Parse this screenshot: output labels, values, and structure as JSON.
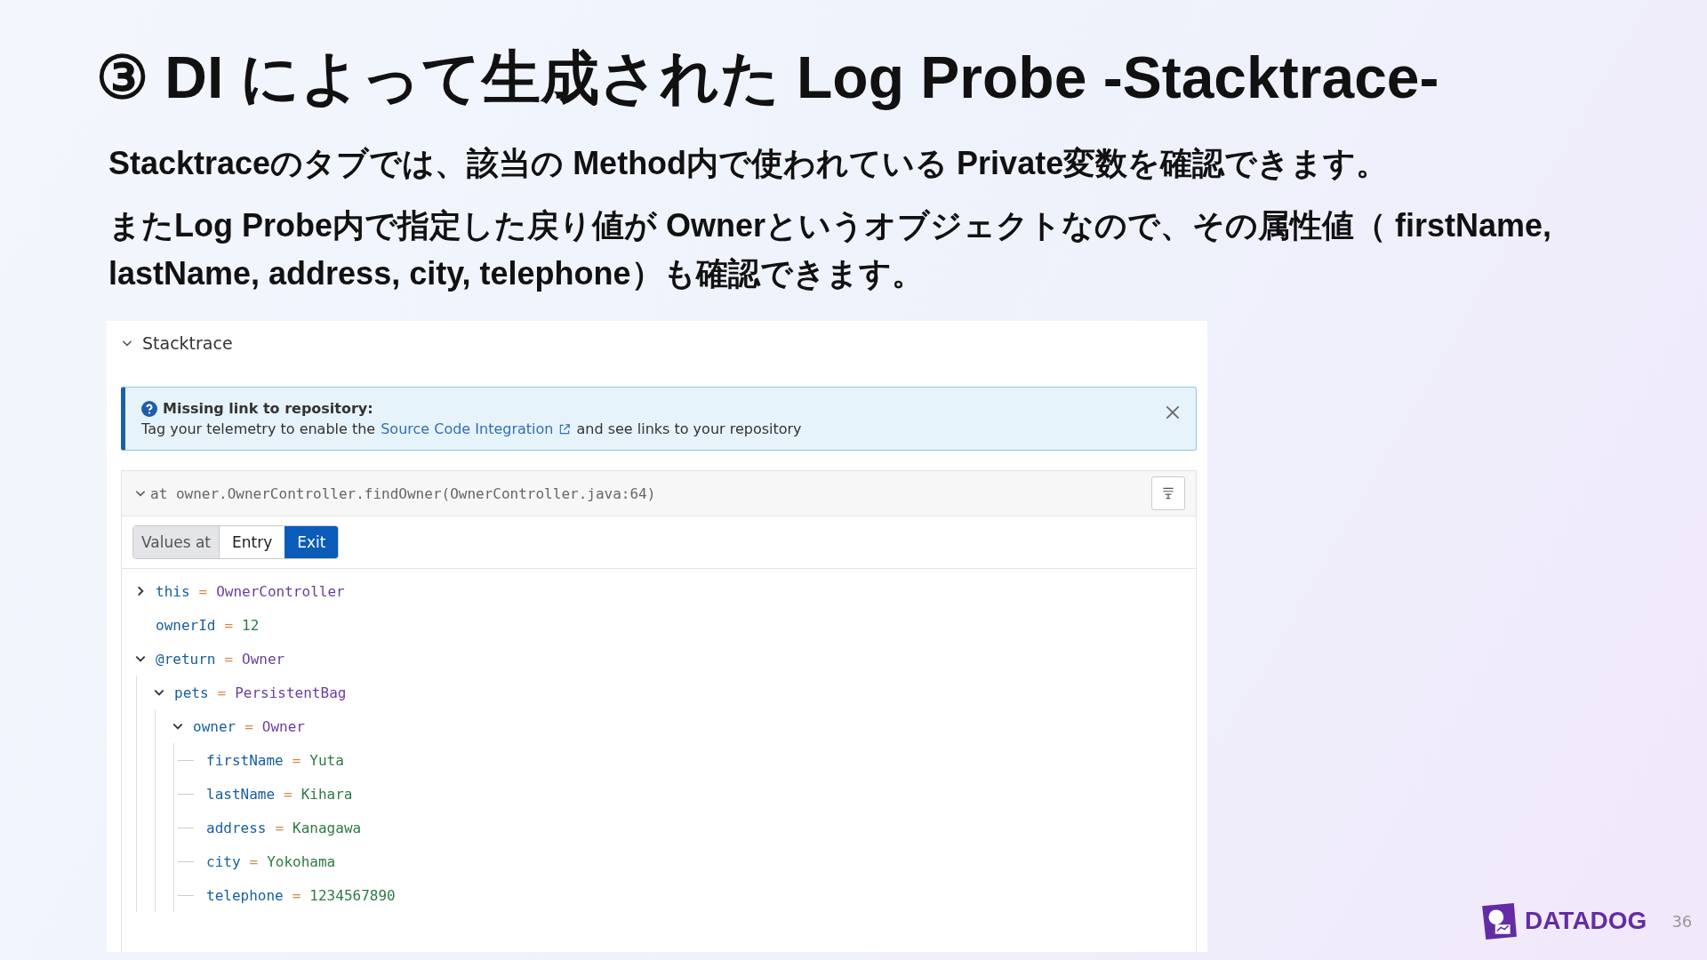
{
  "title": "③ DI によって生成された Log Probe -Stacktrace-",
  "paragraphs": [
    "Stacktraceのタブでは、該当の Method内で使われている Private変数を確認できます。",
    "またLog Probe内で指定した戻り値が Ownerというオブジェクトなので、その属性値（ firstName, lastName, address, city, telephone）も確認できます。"
  ],
  "panel": {
    "section_title": "Stacktrace",
    "section_expanded": true,
    "banner": {
      "heading": "Missing link to repository:",
      "text_before": "Tag your telemetry to enable the",
      "link": "Source Code Integration",
      "text_after": "and see links to your repository"
    },
    "frame": {
      "expanded": true,
      "signature": "at owner.OwnerController.findOwner(OwnerController.java:64)",
      "values_label": "Values at",
      "tabs": [
        {
          "label": "Entry",
          "selected": false
        },
        {
          "label": "Exit",
          "selected": true
        }
      ],
      "variables": [
        {
          "name": "this",
          "operator": "=",
          "value": "OwnerController",
          "kind": "object",
          "expanded": false
        },
        {
          "name": "ownerId",
          "operator": "=",
          "value": "12",
          "kind": "primitive"
        },
        {
          "name": "@return",
          "operator": "=",
          "value": "Owner",
          "kind": "object",
          "expanded": true,
          "children": [
            {
              "name": "pets",
              "operator": "=",
              "value": "PersistentBag",
              "kind": "object",
              "expanded": true,
              "children": [
                {
                  "name": "owner",
                  "operator": "=",
                  "value": "Owner",
                  "kind": "object",
                  "expanded": true,
                  "children": [
                    {
                      "name": "firstName",
                      "operator": "=",
                      "value": "Yuta",
                      "kind": "primitive"
                    },
                    {
                      "name": "lastName",
                      "operator": "=",
                      "value": "Kihara",
                      "kind": "primitive"
                    },
                    {
                      "name": "address",
                      "operator": "=",
                      "value": "Kanagawa",
                      "kind": "primitive"
                    },
                    {
                      "name": "city",
                      "operator": "=",
                      "value": "Yokohama",
                      "kind": "primitive"
                    },
                    {
                      "name": "telephone",
                      "operator": "=",
                      "value": "1234567890",
                      "kind": "primitive"
                    }
                  ]
                }
              ]
            }
          ]
        }
      ]
    }
  },
  "footer": {
    "brand": "DATADOG",
    "page_number": "36"
  }
}
